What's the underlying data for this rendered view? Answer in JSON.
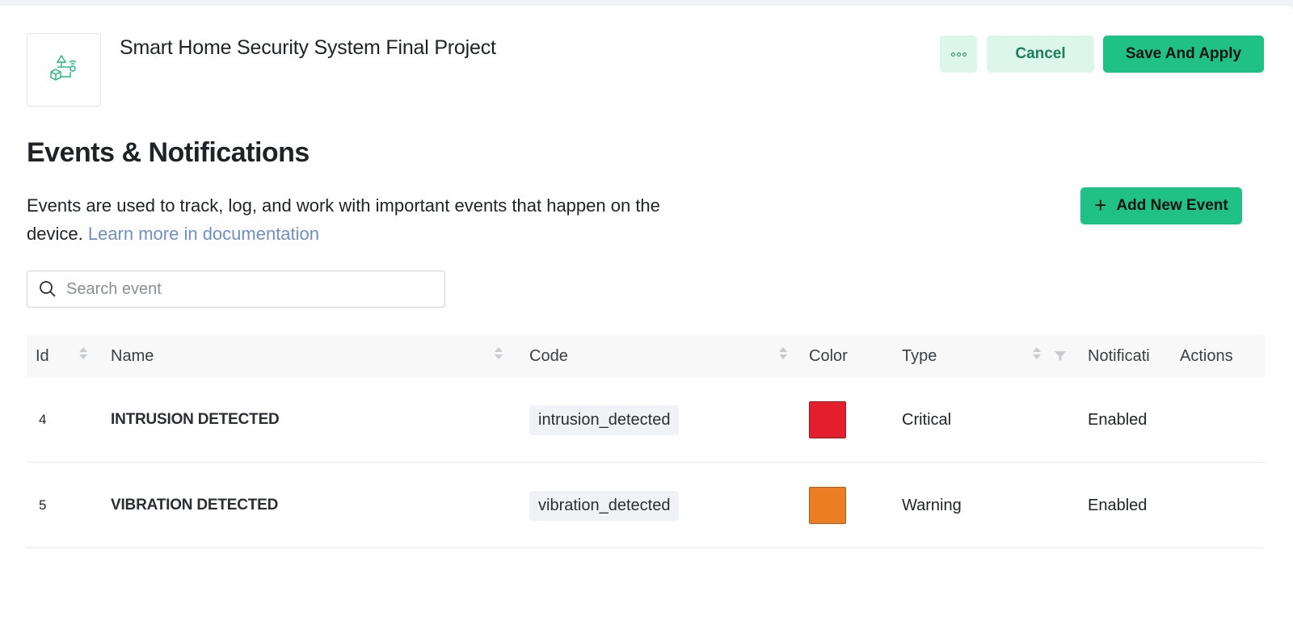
{
  "header": {
    "project_title": "Smart Home Security System Final Project",
    "more_icon": "more-dots-icon",
    "cancel_label": "Cancel",
    "save_label": "Save And Apply"
  },
  "section": {
    "title": "Events & Notifications",
    "description": "Events are used to track, log, and work with important events that happen on the device.",
    "doc_link": "Learn more in documentation",
    "add_button_label": "Add New Event"
  },
  "search": {
    "placeholder": "Search event",
    "value": ""
  },
  "table": {
    "columns": {
      "id": "Id",
      "name": "Name",
      "code": "Code",
      "color": "Color",
      "type": "Type",
      "notifications": "Notificati",
      "actions": "Actions"
    },
    "rows": [
      {
        "id": "4",
        "name": "INTRUSION DETECTED",
        "code": "intrusion_detected",
        "color": "#e31e2d",
        "type": "Critical",
        "notifications": "Enabled"
      },
      {
        "id": "5",
        "name": "VIBRATION DETECTED",
        "code": "vibration_detected",
        "color": "#ed7d23",
        "type": "Warning",
        "notifications": "Enabled"
      }
    ]
  },
  "colors": {
    "accent": "#20c184",
    "accent_light": "#dcf6ec",
    "link": "#6f8fc6"
  }
}
